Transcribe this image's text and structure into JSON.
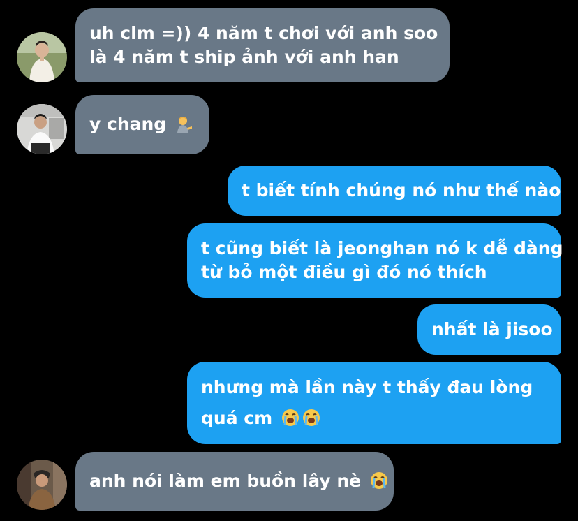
{
  "conversation": {
    "messages": [
      {
        "direction": "incoming",
        "avatar_icon": "avatar-user-1",
        "lines": [
          "uh clm =)) 4 năm t chơi với anh soo",
          "là 4 năm t ship ảnh với anh han"
        ]
      },
      {
        "direction": "incoming",
        "avatar_icon": "avatar-user-2",
        "lines": [
          "y chang "
        ],
        "emoji": "person-tipping-hand-emoji"
      },
      {
        "direction": "outgoing",
        "lines": [
          "t biết tính chúng nó như thế nào"
        ]
      },
      {
        "direction": "outgoing",
        "lines": [
          "t cũng biết là jeonghan nó k dễ dàng",
          "từ bỏ một điều gì đó nó thích"
        ]
      },
      {
        "direction": "outgoing",
        "lines": [
          "nhất là jisoo"
        ]
      },
      {
        "direction": "outgoing",
        "lines": [
          "nhưng mà lần này t thấy đau lòng",
          "quá cm "
        ],
        "emoji": "loudly-crying-face-emoji x2"
      },
      {
        "direction": "incoming",
        "avatar_icon": "avatar-user-3",
        "lines": [
          "anh nói làm em buồn lây nè "
        ],
        "emoji": "loudly-crying-face-emoji"
      }
    ]
  },
  "colors": {
    "background": "#000000",
    "incoming_bubble": "#697887",
    "outgoing_bubble": "#1da1f2",
    "text": "#ffffff"
  }
}
